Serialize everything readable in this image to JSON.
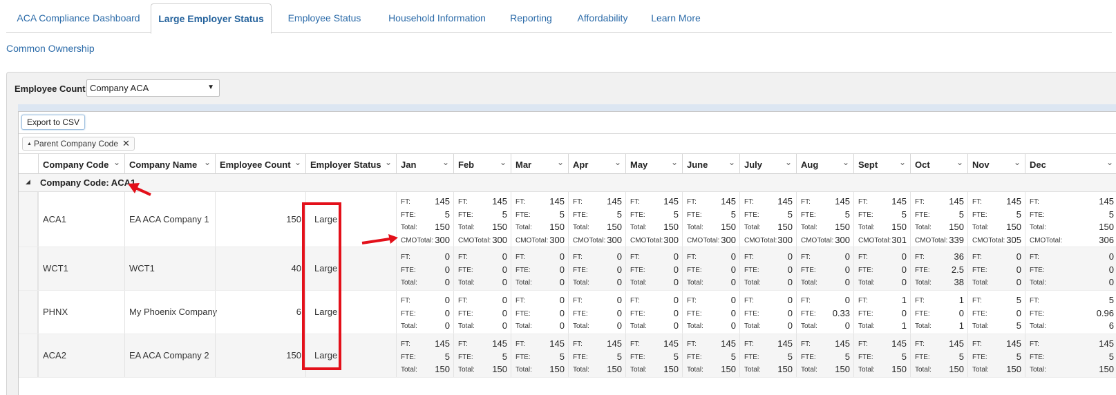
{
  "tabs": [
    {
      "label": "ACA Compliance Dashboard",
      "active": false
    },
    {
      "label": "Large Employer Status",
      "active": true
    },
    {
      "label": "Employee Status",
      "active": false
    },
    {
      "label": "Household Information",
      "active": false
    },
    {
      "label": "Reporting",
      "active": false
    },
    {
      "label": "Affordability",
      "active": false
    },
    {
      "label": "Learn More",
      "active": false
    }
  ],
  "sublink": "Common Ownership",
  "filter": {
    "label": "Employee Count",
    "selected": "Company ACA"
  },
  "toolbar": {
    "export_label": "Export to CSV"
  },
  "grouping": {
    "chip_label": "Parent Company Code"
  },
  "columns": [
    "Company Code",
    "Company Name",
    "Employee Count",
    "Employer Status",
    "Jan",
    "Feb",
    "Mar",
    "Apr",
    "May",
    "June",
    "July",
    "Aug",
    "Sept",
    "Oct",
    "Nov",
    "Dec"
  ],
  "group_header": "Company Code: ACA1",
  "line_labels": {
    "ft": "FT:",
    "fte": "FTE:",
    "total": "Total:",
    "cmo": "CMOTotal:"
  },
  "rows": [
    {
      "code": "ACA1",
      "name": "EA ACA Company 1",
      "count": "150",
      "status": "Large",
      "months": [
        {
          "ft": "145",
          "fte": "5",
          "total": "150",
          "cmo": "300"
        },
        {
          "ft": "145",
          "fte": "5",
          "total": "150",
          "cmo": "300"
        },
        {
          "ft": "145",
          "fte": "5",
          "total": "150",
          "cmo": "300"
        },
        {
          "ft": "145",
          "fte": "5",
          "total": "150",
          "cmo": "300"
        },
        {
          "ft": "145",
          "fte": "5",
          "total": "150",
          "cmo": "300"
        },
        {
          "ft": "145",
          "fte": "5",
          "total": "150",
          "cmo": "300"
        },
        {
          "ft": "145",
          "fte": "5",
          "total": "150",
          "cmo": "300"
        },
        {
          "ft": "145",
          "fte": "5",
          "total": "150",
          "cmo": "300"
        },
        {
          "ft": "145",
          "fte": "5",
          "total": "150",
          "cmo": "301"
        },
        {
          "ft": "145",
          "fte": "5",
          "total": "150",
          "cmo": "339"
        },
        {
          "ft": "145",
          "fte": "5",
          "total": "150",
          "cmo": "305"
        },
        {
          "ft": "145",
          "fte": "5",
          "total": "150",
          "cmo": "306"
        }
      ]
    },
    {
      "code": "WCT1",
      "name": "WCT1",
      "count": "40",
      "status": "Large",
      "months": [
        {
          "ft": "0",
          "fte": "0",
          "total": "0"
        },
        {
          "ft": "0",
          "fte": "0",
          "total": "0"
        },
        {
          "ft": "0",
          "fte": "0",
          "total": "0"
        },
        {
          "ft": "0",
          "fte": "0",
          "total": "0"
        },
        {
          "ft": "0",
          "fte": "0",
          "total": "0"
        },
        {
          "ft": "0",
          "fte": "0",
          "total": "0"
        },
        {
          "ft": "0",
          "fte": "0",
          "total": "0"
        },
        {
          "ft": "0",
          "fte": "0",
          "total": "0"
        },
        {
          "ft": "0",
          "fte": "0",
          "total": "0"
        },
        {
          "ft": "36",
          "fte": "2.5",
          "total": "38"
        },
        {
          "ft": "0",
          "fte": "0",
          "total": "0"
        },
        {
          "ft": "0",
          "fte": "0",
          "total": "0"
        }
      ]
    },
    {
      "code": "PHNX",
      "name": "My Phoenix Company",
      "count": "6",
      "status": "Large",
      "months": [
        {
          "ft": "0",
          "fte": "0",
          "total": "0"
        },
        {
          "ft": "0",
          "fte": "0",
          "total": "0"
        },
        {
          "ft": "0",
          "fte": "0",
          "total": "0"
        },
        {
          "ft": "0",
          "fte": "0",
          "total": "0"
        },
        {
          "ft": "0",
          "fte": "0",
          "total": "0"
        },
        {
          "ft": "0",
          "fte": "0",
          "total": "0"
        },
        {
          "ft": "0",
          "fte": "0",
          "total": "0"
        },
        {
          "ft": "0",
          "fte": "0.33",
          "total": "0"
        },
        {
          "ft": "1",
          "fte": "0",
          "total": "1"
        },
        {
          "ft": "1",
          "fte": "0",
          "total": "1"
        },
        {
          "ft": "5",
          "fte": "0",
          "total": "5"
        },
        {
          "ft": "5",
          "fte": "0.96",
          "total": "6"
        }
      ]
    },
    {
      "code": "ACA2",
      "name": "EA ACA Company 2",
      "count": "150",
      "status": "Large",
      "months": [
        {
          "ft": "145",
          "fte": "5",
          "total": "150"
        },
        {
          "ft": "145",
          "fte": "5",
          "total": "150"
        },
        {
          "ft": "145",
          "fte": "5",
          "total": "150"
        },
        {
          "ft": "145",
          "fte": "5",
          "total": "150"
        },
        {
          "ft": "145",
          "fte": "5",
          "total": "150"
        },
        {
          "ft": "145",
          "fte": "5",
          "total": "150"
        },
        {
          "ft": "145",
          "fte": "5",
          "total": "150"
        },
        {
          "ft": "145",
          "fte": "5",
          "total": "150"
        },
        {
          "ft": "145",
          "fte": "5",
          "total": "150"
        },
        {
          "ft": "145",
          "fte": "5",
          "total": "150"
        },
        {
          "ft": "145",
          "fte": "5",
          "total": "150"
        },
        {
          "ft": "145",
          "fte": "5",
          "total": "150"
        }
      ]
    }
  ],
  "colors": {
    "accent": "#2a6aa8",
    "annotation": "#e3101a"
  }
}
